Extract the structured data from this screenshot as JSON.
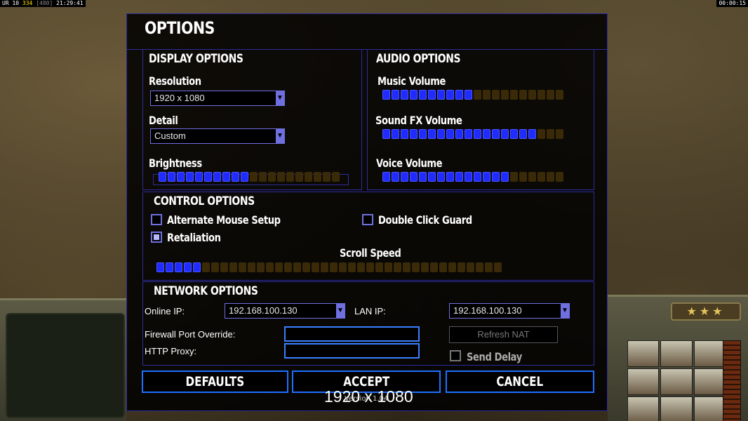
{
  "status_left": {
    "a": "UR 10",
    "b": "334",
    "c": "[480]",
    "d": "21:29:41"
  },
  "timer": "00:00:15",
  "hud": {
    "rank_stars": "★★★"
  },
  "dialog": {
    "title": "OPTIONS",
    "display": {
      "title": "DISPLAY OPTIONS",
      "resolution_label": "Resolution",
      "resolution_value": "1920 x 1080",
      "detail_label": "Detail",
      "detail_value": "Custom",
      "brightness_label": "Brightness",
      "brightness_level": 0.5
    },
    "audio": {
      "title": "AUDIO OPTIONS",
      "music_label": "Music Volume",
      "music_level": 0.5,
      "sfx_label": "Sound FX Volume",
      "sfx_level": 0.85,
      "voice_label": "Voice Volume",
      "voice_level": 0.7
    },
    "control": {
      "title": "CONTROL OPTIONS",
      "alt_mouse_label": "Alternate Mouse Setup",
      "alt_mouse_checked": false,
      "double_click_label": "Double Click Guard",
      "double_click_checked": false,
      "retaliation_label": "Retaliation",
      "retaliation_checked": true,
      "scroll_speed_label": "Scroll Speed",
      "scroll_speed_level": 0.13
    },
    "network": {
      "title": "NETWORK OPTIONS",
      "online_ip_label": "Online IP:",
      "online_ip_value": "192.168.100.130",
      "lan_ip_label": "LAN IP:",
      "lan_ip_value": "192.168.100.130",
      "firewall_label": "Firewall Port Override:",
      "firewall_value": "",
      "http_proxy_label": "HTTP Proxy:",
      "http_proxy_value": "",
      "refresh_nat_label": "Refresh NAT",
      "send_delay_label": "Send Delay",
      "send_delay_checked": false
    },
    "buttons": {
      "defaults": "DEFAULTS",
      "accept": "ACCEPT",
      "cancel": "CANCEL"
    },
    "version": "Version 1.04",
    "resolution_overlay": "1920 x 1080"
  },
  "colors": {
    "panel_border": "#2c2c9c",
    "slider_on": "#1f2bff",
    "slider_off": "#3a2a08",
    "button_border": "#1f6fff"
  }
}
